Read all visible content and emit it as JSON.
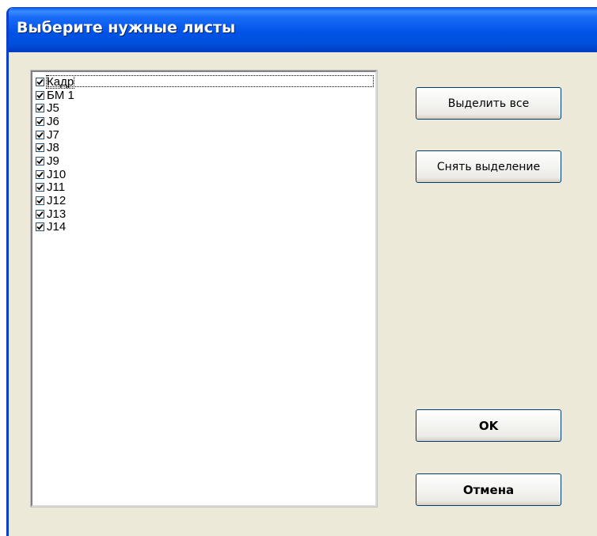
{
  "window": {
    "title": "Выберите нужные листы"
  },
  "list": {
    "items": [
      {
        "label": "Кадр",
        "checked": true
      },
      {
        "label": "БМ 1",
        "checked": true
      },
      {
        "label": "J5",
        "checked": true
      },
      {
        "label": "J6",
        "checked": true
      },
      {
        "label": "J7",
        "checked": true
      },
      {
        "label": "J8",
        "checked": true
      },
      {
        "label": "J9",
        "checked": true
      },
      {
        "label": "J10",
        "checked": true
      },
      {
        "label": "J11",
        "checked": true
      },
      {
        "label": "J12",
        "checked": true
      },
      {
        "label": "J13",
        "checked": true
      },
      {
        "label": "J14",
        "checked": true
      }
    ]
  },
  "buttons": {
    "select_all": "Выделить все",
    "deselect": "Снять выделение",
    "ok": "OK",
    "cancel": "Отмена"
  },
  "colors": {
    "titlebar": "#0053e6",
    "window_bg": "#ece9d8",
    "button_border": "#003c74",
    "checkmark": "#21a121"
  },
  "icons": {
    "checkbox_checked": "checkmark-icon"
  }
}
